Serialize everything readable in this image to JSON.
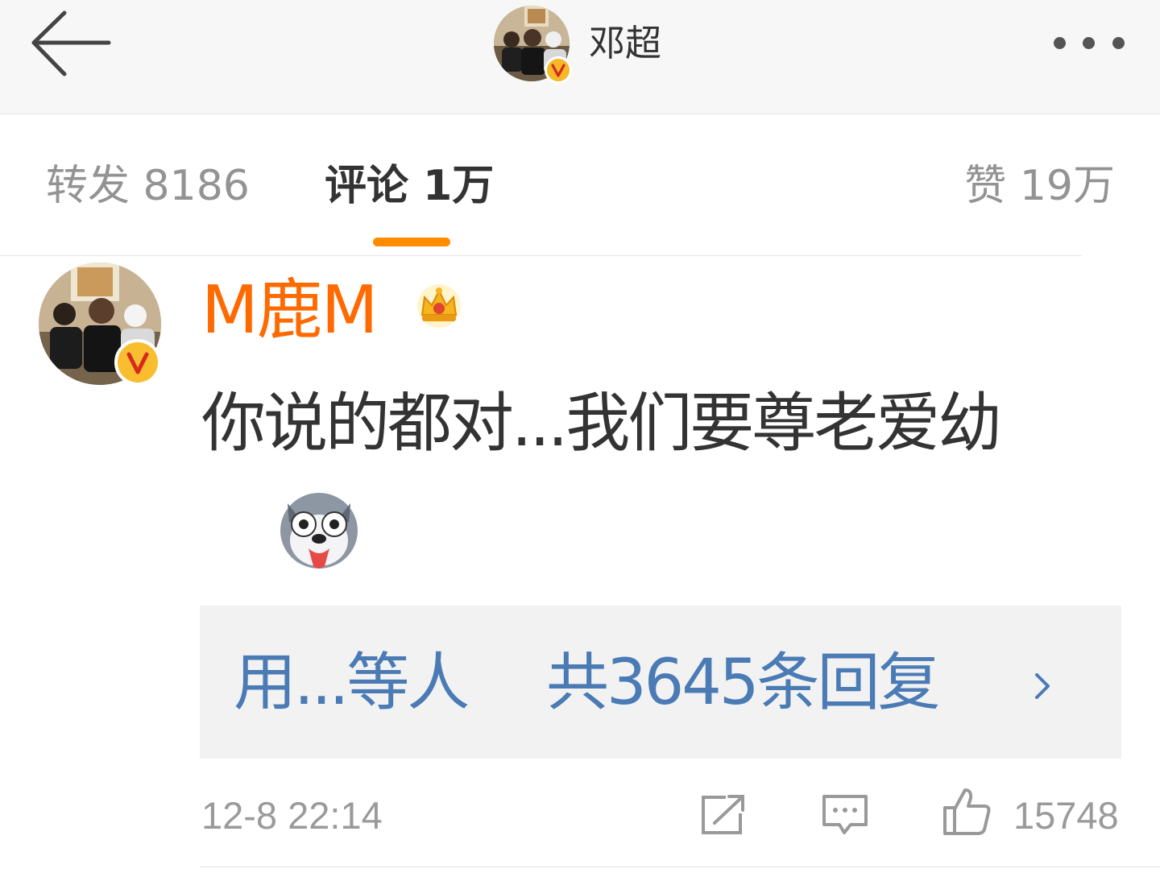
{
  "header": {
    "title": "邓超",
    "back_icon": "arrow-left-icon",
    "more_icon": "more-dots-icon",
    "verified_badge": "V"
  },
  "tabs": [
    {
      "label": "转发",
      "count": "8186"
    },
    {
      "label": "评论",
      "count": "1万"
    },
    {
      "label": "赞",
      "count": "19万"
    }
  ],
  "active_tab_index": 1,
  "colors": {
    "accent": "#ff8c00",
    "username": "#ff6a00",
    "link_blue": "#4a7bb5",
    "badge": "#f6b829"
  },
  "comment": {
    "username": "M鹿M",
    "member_icon": "crown-icon",
    "verified_badge": "V",
    "text": "你说的都对...我们要尊老爱幼",
    "emoji_icon": "husky-emoji-icon",
    "replies_users": "用...等人",
    "replies_count": "共3645条回复",
    "time": "12-8 22:14",
    "like_count": "15748"
  }
}
